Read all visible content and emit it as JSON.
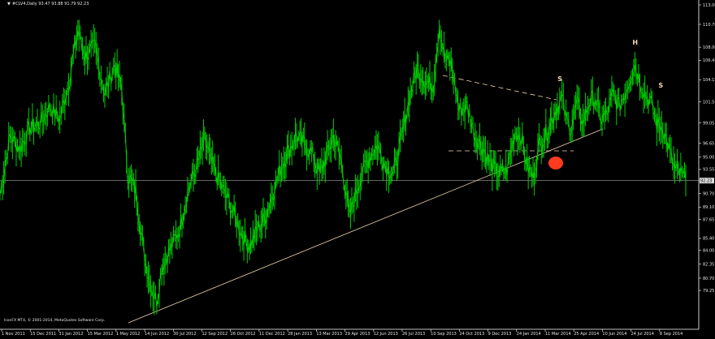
{
  "window": {
    "title": "#CLV4,Daily  93.47 93.88 91.79 92.23",
    "menu_icon": "dropdown-triangle-icon"
  },
  "footer": {
    "copyright": "IconFX MT4, © 2001-2014, MetaQuotes Software Corp."
  },
  "colors": {
    "background": "#000000",
    "candles": "#00cc00",
    "axis": "#ffffff",
    "trendline": "#f1d6b0",
    "marker": "#ff3b1f"
  },
  "chart_data": {
    "type": "line",
    "symbol": "#CLV4",
    "timeframe": "Daily",
    "ohlc": {
      "open": 93.47,
      "high": 93.88,
      "low": 91.79,
      "close": 92.23
    },
    "current_price": "92.23",
    "ylim": [
      76.0,
      113.0
    ],
    "y_ticks": [
      "113.00",
      "110.70",
      "108.00",
      "106.45",
      "104.15",
      "101.55",
      "99.05",
      "96.65",
      "95.00",
      "93.55",
      "90.70",
      "89.10",
      "87.65",
      "85.40",
      "84.00",
      "82.35",
      "80.70",
      "79.25"
    ],
    "x_ticks": [
      "1 Nov 2011",
      "15 Dec 2011",
      "31 Jan 2012",
      "15 Mar 2012",
      "1 May 2012",
      "14 Jun 2012",
      "30 Jul 2012",
      "12 Sep 2012",
      "26 Oct 2012",
      "11 Dec 2012",
      "28 Jan 2013",
      "13 Mar 2013",
      "29 Apr 2013",
      "12 Jun 2013",
      "26 Jul 2013",
      "10 Sep 2013",
      "24 Oct 2013",
      "9 Dec 2013",
      "24 Jan 2014",
      "11 Mar 2014",
      "25 Apr 2014",
      "10 Jun 2014",
      "24 Jul 2014",
      "8 Sep 2014"
    ],
    "series": [
      {
        "values": [
          [
            0,
            90.5
          ],
          [
            10,
            97.5
          ],
          [
            20,
            96.0
          ],
          [
            30,
            98.5
          ],
          [
            40,
            99.0
          ],
          [
            50,
            101.0
          ],
          [
            60,
            99.5
          ],
          [
            70,
            104.5
          ],
          [
            78,
            110.0
          ],
          [
            85,
            107.0
          ],
          [
            95,
            108.0
          ],
          [
            105,
            102.5
          ],
          [
            115,
            106.0
          ],
          [
            122,
            103.0
          ],
          [
            128,
            93.0
          ],
          [
            136,
            91.0
          ],
          [
            145,
            83.0
          ],
          [
            152,
            79.5
          ],
          [
            157,
            78.0
          ],
          [
            162,
            82.0
          ],
          [
            170,
            84.0
          ],
          [
            180,
            86.5
          ],
          [
            188,
            91.0
          ],
          [
            196,
            93.5
          ],
          [
            205,
            97.0
          ],
          [
            213,
            94.0
          ],
          [
            222,
            91.5
          ],
          [
            232,
            89.0
          ],
          [
            242,
            86.0
          ],
          [
            250,
            84.5
          ],
          [
            258,
            86.5
          ],
          [
            266,
            88.0
          ],
          [
            274,
            91.0
          ],
          [
            282,
            94.0
          ],
          [
            290,
            96.0
          ],
          [
            297,
            97.5
          ],
          [
            305,
            96.5
          ],
          [
            312,
            95.5
          ],
          [
            320,
            93.0
          ],
          [
            327,
            95.0
          ],
          [
            334,
            97.5
          ],
          [
            342,
            94.5
          ],
          [
            350,
            88.0
          ],
          [
            356,
            90.5
          ],
          [
            362,
            93.0
          ],
          [
            370,
            95.0
          ],
          [
            378,
            96.5
          ],
          [
            386,
            94.0
          ],
          [
            394,
            93.0
          ],
          [
            402,
            97.0
          ],
          [
            410,
            102.0
          ],
          [
            418,
            105.5
          ],
          [
            426,
            104.0
          ],
          [
            434,
            103.5
          ],
          [
            440,
            110.5
          ],
          [
            446,
            106.5
          ],
          [
            452,
            106.0
          ],
          [
            460,
            100.5
          ],
          [
            468,
            101.0
          ],
          [
            476,
            97.5
          ],
          [
            484,
            96.0
          ],
          [
            492,
            94.0
          ],
          [
            500,
            93.0
          ],
          [
            508,
            93.5
          ],
          [
            516,
            98.0
          ],
          [
            522,
            97.5
          ],
          [
            528,
            94.0
          ],
          [
            534,
            92.5
          ],
          [
            540,
            96.5
          ],
          [
            548,
            98.0
          ],
          [
            556,
            100.5
          ],
          [
            563,
            102.0
          ],
          [
            567,
            99.5
          ],
          [
            572,
            98.5
          ],
          [
            578,
            101.5
          ],
          [
            584,
            99.0
          ],
          [
            590,
            101.5
          ],
          [
            596,
            102.0
          ],
          [
            602,
            99.5
          ],
          [
            608,
            100.0
          ],
          [
            614,
            102.5
          ],
          [
            620,
            101.0
          ],
          [
            626,
            102.5
          ],
          [
            630,
            104.0
          ],
          [
            636,
            106.0
          ],
          [
            641,
            104.0
          ],
          [
            646,
            102.5
          ],
          [
            652,
            101.5
          ],
          [
            658,
            99.0
          ],
          [
            664,
            98.5
          ],
          [
            670,
            96.0
          ],
          [
            676,
            93.5
          ],
          [
            682,
            93.0
          ],
          [
            687,
            92.23
          ]
        ]
      }
    ],
    "annotations": [
      {
        "type": "text",
        "label": "S",
        "t": 561,
        "value": 104.0
      },
      {
        "type": "text",
        "label": "H",
        "t": 636,
        "value": 108.3
      },
      {
        "type": "text",
        "label": "S",
        "t": 662,
        "value": 103.2
      }
    ]
  }
}
